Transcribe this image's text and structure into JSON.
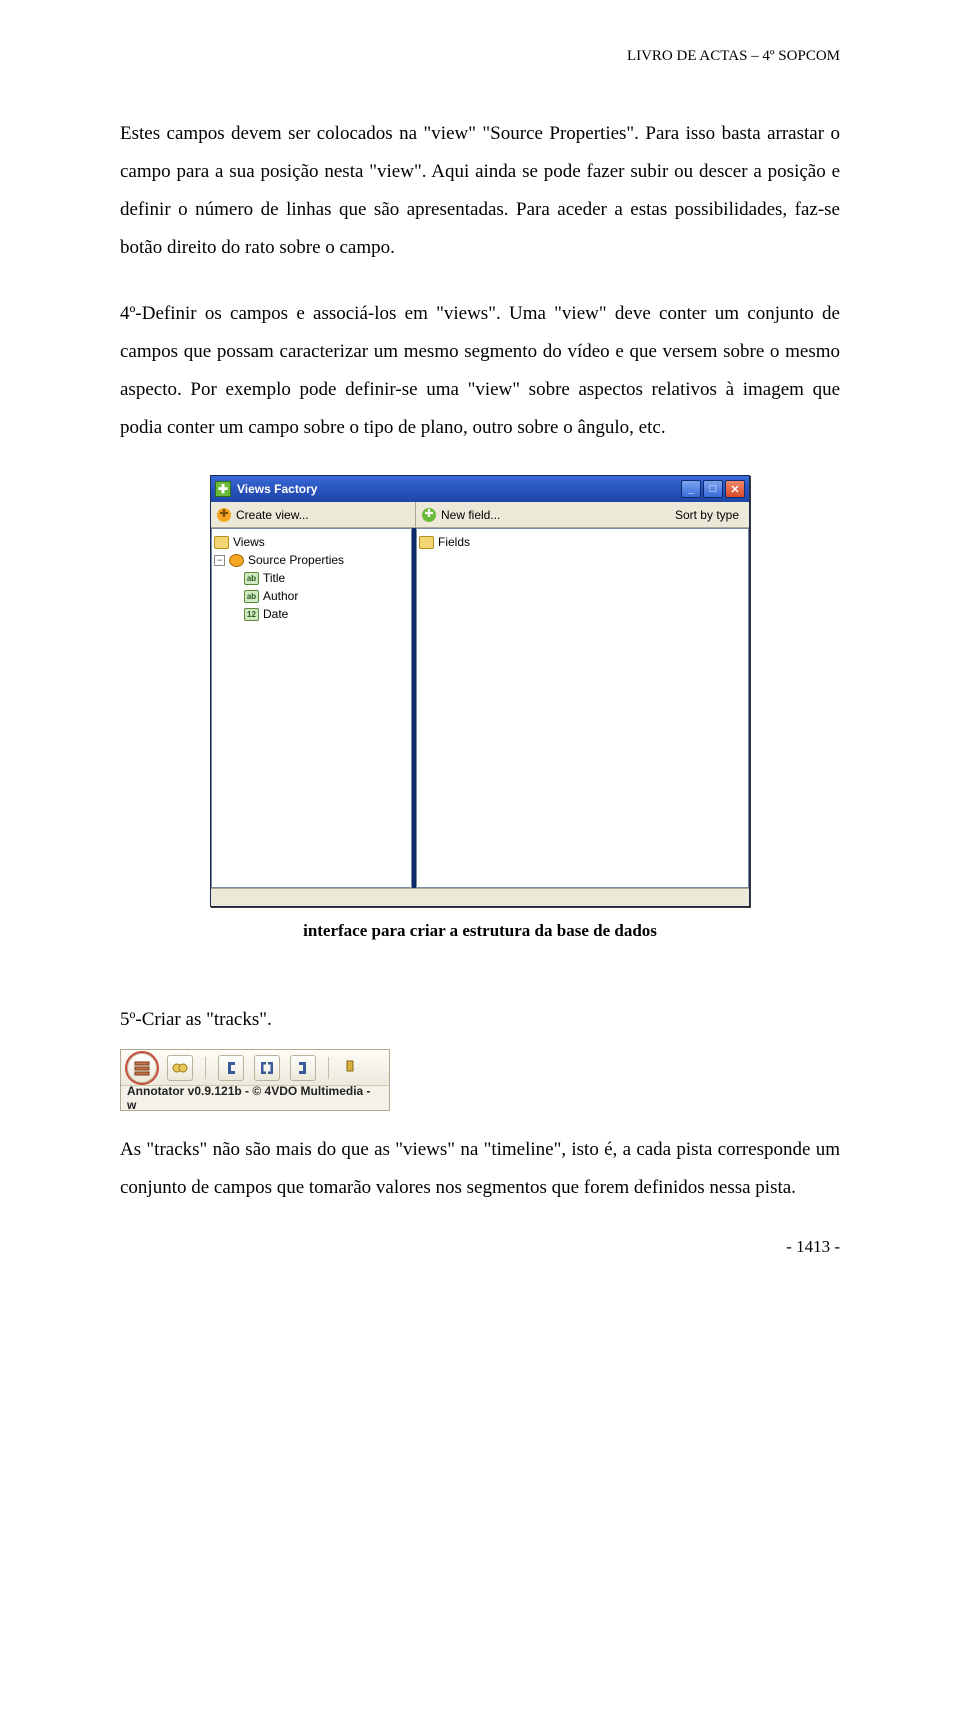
{
  "header": "LIVRO DE ACTAS – 4º SOPCOM",
  "paragraphs": {
    "p1": "Estes campos devem ser colocados na \"view\" \"Source Properties\". Para isso basta arrastar o campo para a sua posição nesta \"view\". Aqui ainda se pode fazer subir ou descer a posição e definir o número de linhas que são apresentadas. Para aceder a estas possibilidades, faz-se botão direito do rato sobre o campo.",
    "p2": "4º-Definir os campos e associá-los em \"views\". Uma \"view\" deve conter um conjunto de campos que possam caracterizar um mesmo segmento do vídeo e que versem sobre o mesmo aspecto. Por exemplo pode definir-se uma \"view\" sobre aspectos relativos à imagem que podia conter um campo sobre o tipo de plano, outro sobre o ângulo, etc.",
    "caption": "interface para criar a estrutura da base de dados",
    "p3": "5º-Criar as \"tracks\".",
    "p4": "As \"tracks\" não são mais do que as \"views\" na \"timeline\", isto é, a cada pista corresponde um conjunto de campos que tomarão valores nos segmentos que forem definidos nessa pista."
  },
  "views_factory": {
    "title": "Views Factory",
    "toolbar": {
      "create_view": "Create view...",
      "new_field": "New field...",
      "sort_by_type": "Sort by type"
    },
    "left_root": "Views",
    "right_root": "Fields",
    "tree": {
      "n0": "Source Properties",
      "n1": "Title",
      "n2": "Author",
      "n3": "Date"
    }
  },
  "annotator_bar": {
    "caption": "Annotator v0.9.121b - © 4VDO Multimedia - w"
  },
  "footer": "- 1413 -"
}
